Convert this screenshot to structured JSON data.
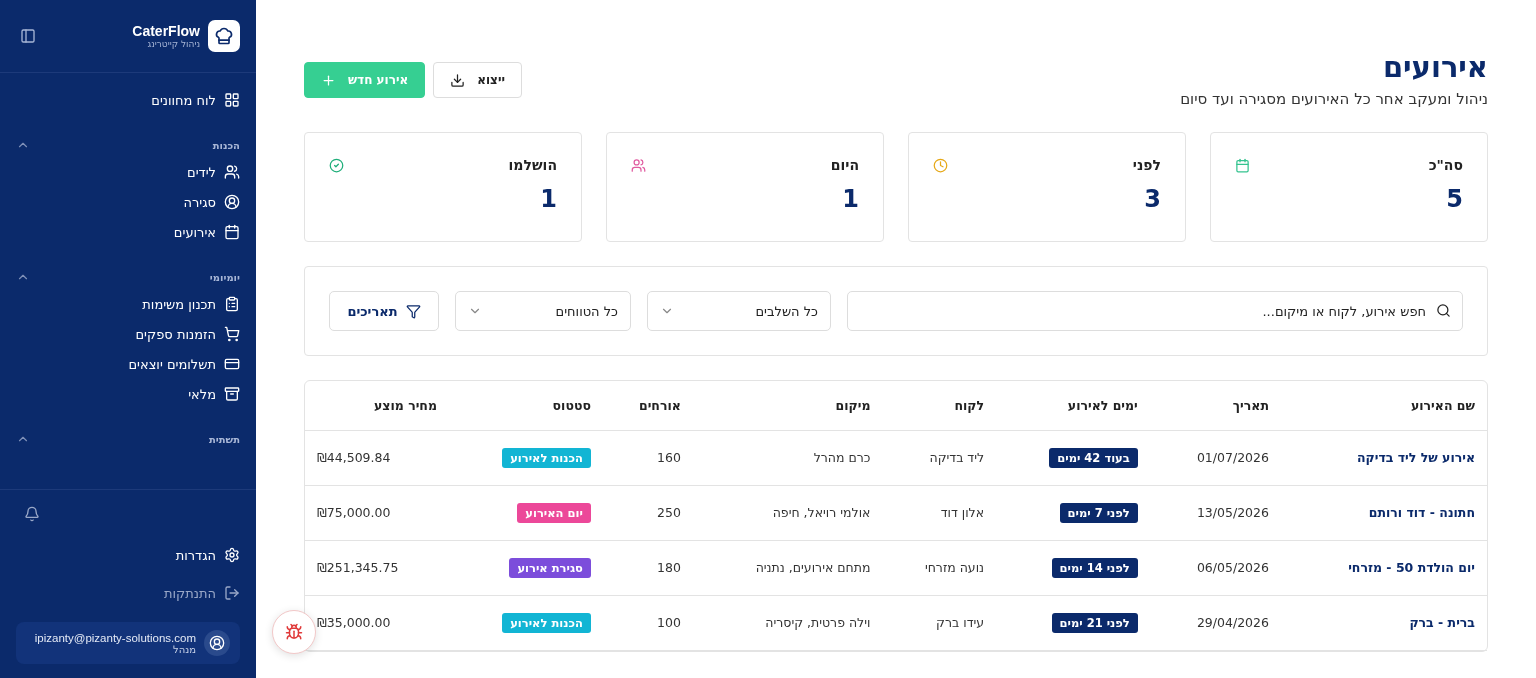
{
  "sidebar": {
    "brand": "CaterFlow",
    "tagline": "ניהול קייטרינג",
    "top_item": "לוח מחוונים",
    "groups": [
      {
        "title": "הכנות",
        "expanded": true,
        "items": [
          "לידים",
          "סגירה",
          "אירועים"
        ]
      },
      {
        "title": "יומיומי",
        "expanded": true,
        "items": [
          "תכנון משימות",
          "הזמנות ספקים",
          "תשלומים יוצאים",
          "מלאי"
        ]
      },
      {
        "title": "תשתית",
        "expanded": true
      }
    ],
    "settings": "הגדרות",
    "logout": "התנתקות",
    "user": {
      "email": "ipizanty@pizanty-solutions.com",
      "role": "מנהל"
    }
  },
  "header": {
    "title": "אירועים",
    "subtitle": "ניהול ומעקב אחר כל האירועים מסגירה ועד סיום",
    "export_button": "ייצוא",
    "new_button": "אירוע חדש"
  },
  "stats": [
    {
      "label": "סה\"כ",
      "value": "5"
    },
    {
      "label": "לפני",
      "value": "3"
    },
    {
      "label": "היום",
      "value": "1"
    },
    {
      "label": "הושלמו",
      "value": "1"
    }
  ],
  "filters": {
    "search_placeholder": "חפש אירוע, לקוח או מיקום...",
    "stage_select": "כל השלבים",
    "range_select": "כל הטווחים",
    "dates_button": "תאריכים"
  },
  "table": {
    "columns": [
      "שם האירוע",
      "תאריך",
      "ימים לאירוע",
      "לקוח",
      "מיקום",
      "אורחים",
      "סטטוס",
      "מחיר מוצע"
    ],
    "rows": [
      {
        "name": "אירוע של ליד בדיקה",
        "date": "01/07/2026",
        "days": "בעוד 42 ימים",
        "client": "ליד בדיקה",
        "location": "כרם מהרל",
        "guests": "160",
        "status": "הכנות לאירוע",
        "color": "#12b5d4",
        "price": "₪44,509.84"
      },
      {
        "name": "חתונה - דוד ורותם",
        "date": "13/05/2026",
        "days": "לפני 7 ימים",
        "client": "אלון דוד",
        "location": "אולמי רויאל, חיפה",
        "guests": "250",
        "status": "יום האירוע",
        "color": "#ec4899",
        "price": "₪75,000.00"
      },
      {
        "name": "יום הולדת 50 - מזרחי",
        "date": "06/05/2026",
        "days": "לפני 14 ימים",
        "client": "נועה מזרחי",
        "location": "מתחם אירועים, נתניה",
        "guests": "180",
        "status": "סגירת אירוע",
        "color": "#7c4ddb",
        "price": "₪251,345.75"
      },
      {
        "name": "ברית - ברק",
        "date": "29/04/2026",
        "days": "לפני 21 ימים",
        "client": "עידו ברק",
        "location": "וילה פרטית, קיסריה",
        "guests": "100",
        "status": "הכנות לאירוע",
        "color": "#12b5d4",
        "price": "₪35,000.00"
      }
    ]
  }
}
